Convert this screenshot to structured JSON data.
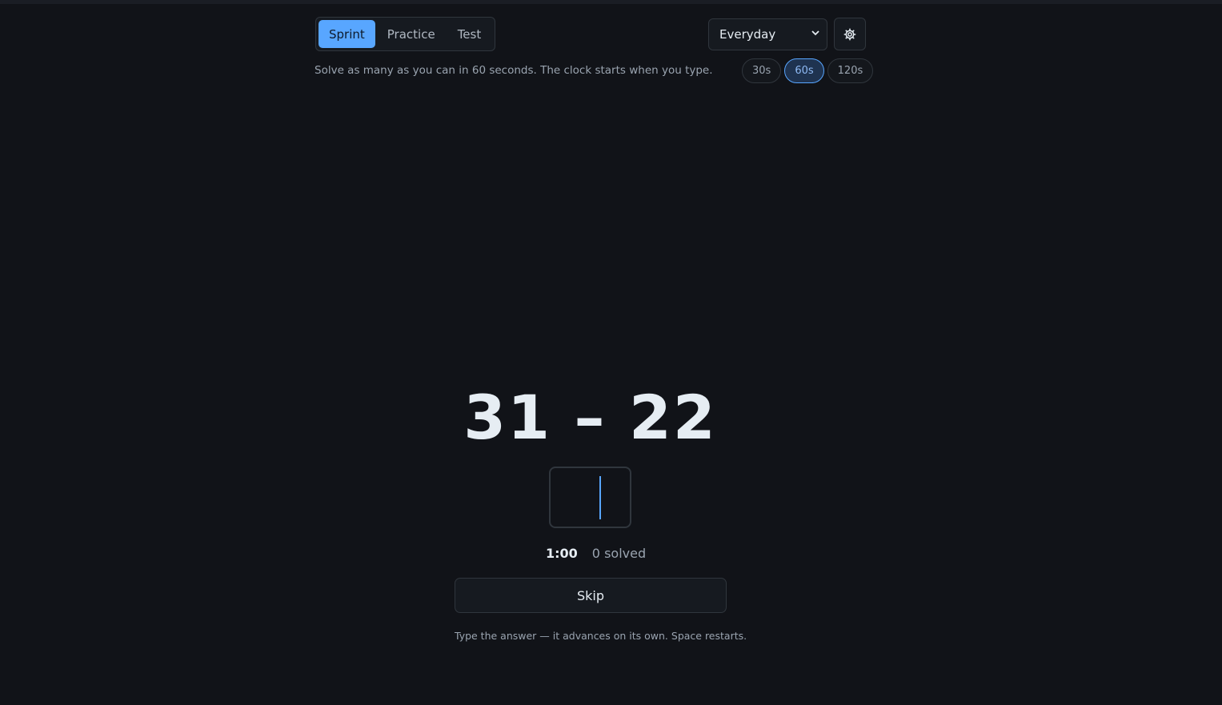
{
  "header": {
    "tabs": [
      {
        "label": "Sprint",
        "active": true
      },
      {
        "label": "Practice",
        "active": false
      },
      {
        "label": "Test",
        "active": false
      }
    ],
    "deck_select": {
      "selected": "Everyday"
    },
    "settings_icon": "gear-icon"
  },
  "description": "Solve as many as you can in 60 seconds. The clock starts when you type.",
  "durations": [
    {
      "label": "30s",
      "active": false
    },
    {
      "label": "60s",
      "active": true
    },
    {
      "label": "120s",
      "active": false
    }
  ],
  "problem": {
    "text": "31 – 22"
  },
  "answer": {
    "value": ""
  },
  "stats": {
    "timer": "1:00",
    "solved": "0 solved"
  },
  "skip_label": "Skip",
  "hint": "Type the answer — it advances on its own. Space restarts.",
  "colors": {
    "accent": "#58a6ff",
    "background": "#111318",
    "border": "#30363d"
  }
}
